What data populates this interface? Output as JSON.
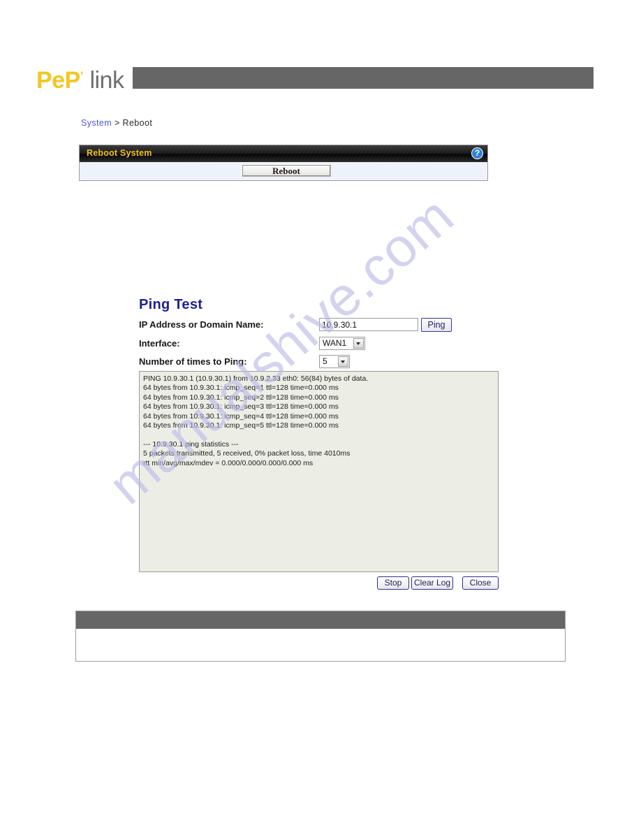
{
  "brand": {
    "logo_primary": "PeP",
    "logo_tick": "’",
    "logo_secondary": "link",
    "primary_color": "#f2c623",
    "secondary_color": "#6e6e6e",
    "bar_color": "#666666"
  },
  "breadcrumb": {
    "parent": "System",
    "separator": ">",
    "current": "Reboot"
  },
  "reboot_panel": {
    "title": "Reboot System",
    "title_color": "#f3c01a",
    "help_icon": "question-mark-icon",
    "help_label": "?",
    "reboot_button": "Reboot"
  },
  "ping_test": {
    "title": "Ping Test",
    "title_color": "#1f1f93",
    "fields": {
      "ip_label": "IP Address or Domain Name:",
      "ip_value": "10.9.30.1",
      "ip_placeholder": "",
      "ping_button": "Ping",
      "interface_label": "Interface:",
      "interface_value": "WAN1",
      "interface_options": [
        "WAN1"
      ],
      "count_label": "Number of times to Ping:",
      "count_value": "5",
      "count_options": [
        "5"
      ]
    },
    "log_output": "PING 10.9.30.1 (10.9.30.1) from 10.9.2.33 eth0: 56(84) bytes of data.\n64 bytes from 10.9.30.1: icmp_seq=1 ttl=128 time=0.000 ms\n64 bytes from 10.9.30.1: icmp_seq=2 ttl=128 time=0.000 ms\n64 bytes from 10.9.30.1: icmp_seq=3 ttl=128 time=0.000 ms\n64 bytes from 10.9.30.1: icmp_seq=4 ttl=128 time=0.000 ms\n64 bytes from 10.9.30.1: icmp_seq=5 ttl=128 time=0.000 ms\n\n--- 10.9.30.1 ping statistics ---\n5 packets transmitted, 5 received, 0% packet loss, time 4010ms\nrtt min/avg/max/mdev = 0.000/0.000/0.000/0.000 ms",
    "buttons": {
      "stop": "Stop",
      "clear_log": "Clear Log",
      "close": "Close"
    }
  },
  "bottom_panel": {
    "header_text": "",
    "body_text": ""
  },
  "watermark": {
    "text": "manualshive.com",
    "color": "#b9b9e8"
  }
}
